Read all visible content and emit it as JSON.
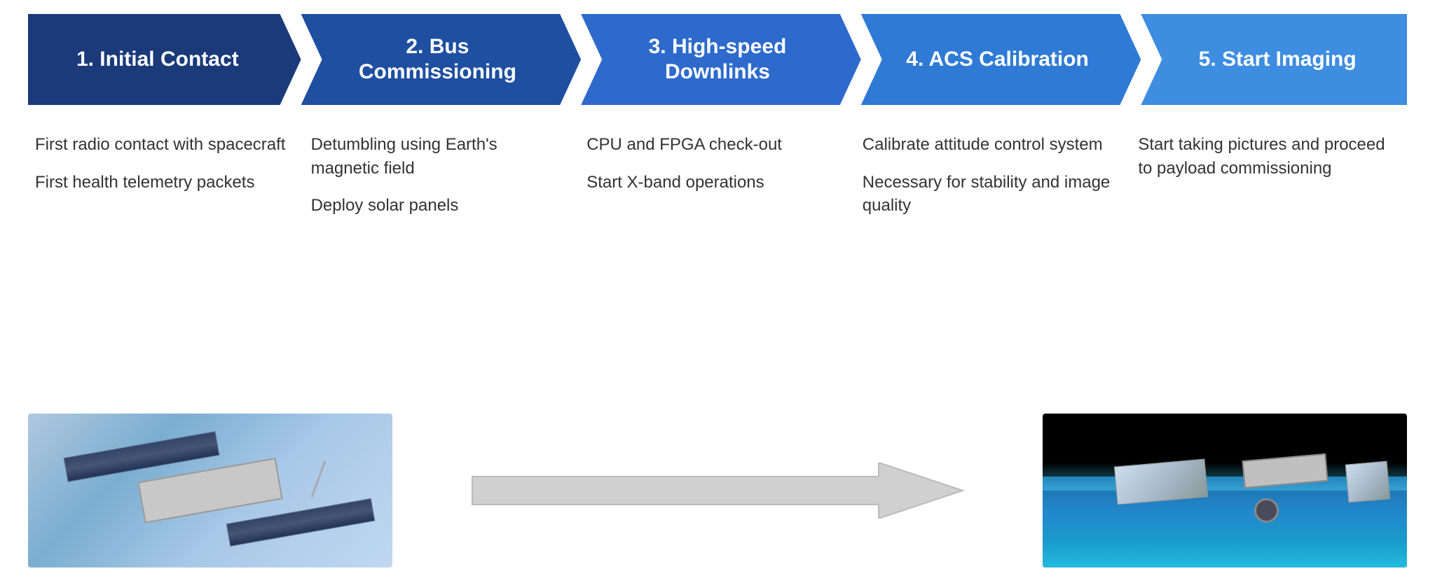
{
  "chevrons": [
    {
      "id": "initial-contact",
      "label": "1. Initial Contact",
      "colorClass": "chevron-1"
    },
    {
      "id": "bus-commissioning",
      "label": "2. Bus Commissioning",
      "colorClass": "chevron-2"
    },
    {
      "id": "high-speed-downlinks",
      "label": "3. High-speed Downlinks",
      "colorClass": "chevron-3"
    },
    {
      "id": "acs-calibration",
      "label": "4. ACS Calibration",
      "colorClass": "chevron-4"
    },
    {
      "id": "start-imaging",
      "label": "5. Start Imaging",
      "colorClass": "chevron-5"
    }
  ],
  "columns": [
    {
      "id": "col-initial-contact",
      "items": [
        "First radio contact with spacecraft",
        "First health telemetry packets"
      ]
    },
    {
      "id": "col-bus-commissioning",
      "items": [
        "Detumbling using Earth's magnetic field",
        "Deploy solar panels"
      ]
    },
    {
      "id": "col-high-speed-downlinks",
      "items": [
        "CPU and FPGA check-out",
        "Start X-band operations"
      ]
    },
    {
      "id": "col-acs-calibration",
      "items": [
        "Calibrate attitude control system",
        "Necessary for stability and image quality"
      ]
    },
    {
      "id": "col-start-imaging",
      "items": [
        "Start taking pictures and proceed to payload commissioning"
      ]
    }
  ],
  "arrow": {
    "fill": "#d8d8d8",
    "stroke": "#bbbbbb"
  },
  "images": {
    "left_alt": "Satellite in orbit - initial state",
    "right_alt": "Satellite imaging Earth"
  }
}
